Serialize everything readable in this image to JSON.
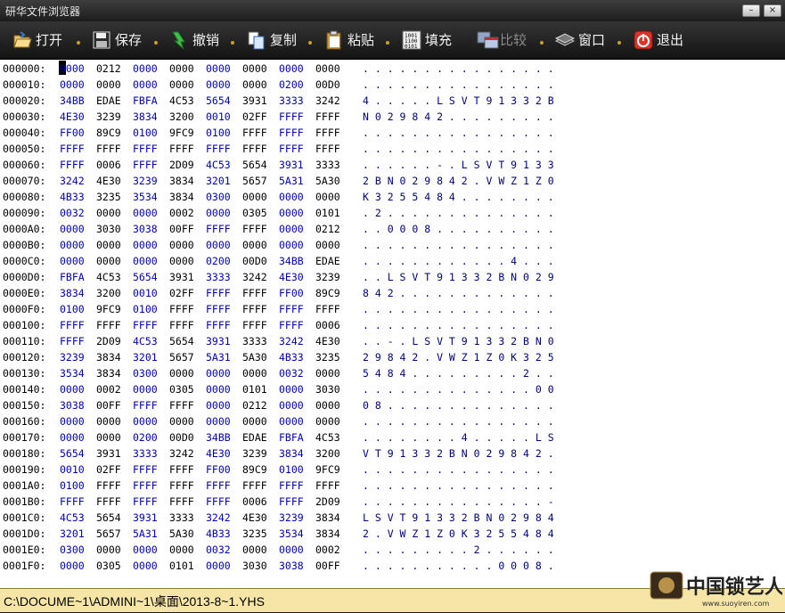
{
  "window": {
    "title": "研华文件浏览器",
    "min_label": "–",
    "close_label": "×"
  },
  "toolbar": {
    "open": "打开",
    "save": "保存",
    "undo": "撤销",
    "copy": "复制",
    "paste": "粘贴",
    "fill": "填充",
    "compare": "比较",
    "window": "窗口",
    "exit": "退出"
  },
  "rows": [
    {
      "a": "000000:",
      "h": [
        "0000",
        "0212",
        "0000",
        "0000",
        "0000",
        "0000",
        "0000",
        "0000"
      ],
      "t": ". . . . . . . . . . . . . . . ."
    },
    {
      "a": "000010:",
      "h": [
        "0000",
        "0000",
        "0000",
        "0000",
        "0000",
        "0000",
        "0200",
        "00D0"
      ],
      "t": ". . . . . . . . . . . . . . . ."
    },
    {
      "a": "000020:",
      "h": [
        "34BB",
        "EDAE",
        "FBFA",
        "4C53",
        "5654",
        "3931",
        "3333",
        "3242"
      ],
      "t": "4 . . . . . L S V T 9 1 3 3 2 B"
    },
    {
      "a": "000030:",
      "h": [
        "4E30",
        "3239",
        "3834",
        "3200",
        "0010",
        "02FF",
        "FFFF",
        "FFFF"
      ],
      "t": "N 0 2 9 8 4 2 . . . . . . . . ."
    },
    {
      "a": "000040:",
      "h": [
        "FF00",
        "89C9",
        "0100",
        "9FC9",
        "0100",
        "FFFF",
        "FFFF",
        "FFFF"
      ],
      "t": ". . . . . . . . . . . . . . . ."
    },
    {
      "a": "000050:",
      "h": [
        "FFFF",
        "FFFF",
        "FFFF",
        "FFFF",
        "FFFF",
        "FFFF",
        "FFFF",
        "FFFF"
      ],
      "t": ". . . . . . . . . . . . . . . ."
    },
    {
      "a": "000060:",
      "h": [
        "FFFF",
        "0006",
        "FFFF",
        "2D09",
        "4C53",
        "5654",
        "3931",
        "3333"
      ],
      "t": ". . . . . . - . L S V T 9 1 3 3"
    },
    {
      "a": "000070:",
      "h": [
        "3242",
        "4E30",
        "3239",
        "3834",
        "3201",
        "5657",
        "5A31",
        "5A30"
      ],
      "t": "2 B N 0 2 9 8 4 2 . V W Z 1 Z 0"
    },
    {
      "a": "000080:",
      "h": [
        "4B33",
        "3235",
        "3534",
        "3834",
        "0300",
        "0000",
        "0000",
        "0000"
      ],
      "t": "K 3 2 5 5 4 8 4 . . . . . . . ."
    },
    {
      "a": "000090:",
      "h": [
        "0032",
        "0000",
        "0000",
        "0002",
        "0000",
        "0305",
        "0000",
        "0101"
      ],
      "t": ". 2 . . . . . . . . . . . . . ."
    },
    {
      "a": "0000A0:",
      "h": [
        "0000",
        "3030",
        "3038",
        "00FF",
        "FFFF",
        "FFFF",
        "0000",
        "0212"
      ],
      "t": ". . 0 0 0 8 . . . . . . . . . ."
    },
    {
      "a": "0000B0:",
      "h": [
        "0000",
        "0000",
        "0000",
        "0000",
        "0000",
        "0000",
        "0000",
        "0000"
      ],
      "t": ". . . . . . . . . . . . . . . ."
    },
    {
      "a": "0000C0:",
      "h": [
        "0000",
        "0000",
        "0000",
        "0000",
        "0200",
        "00D0",
        "34BB",
        "EDAE"
      ],
      "t": ". . . . . . . . . . . . 4 . . ."
    },
    {
      "a": "0000D0:",
      "h": [
        "FBFA",
        "4C53",
        "5654",
        "3931",
        "3333",
        "3242",
        "4E30",
        "3239"
      ],
      "t": ". . L S V T 9 1 3 3 2 B N 0 2 9"
    },
    {
      "a": "0000E0:",
      "h": [
        "3834",
        "3200",
        "0010",
        "02FF",
        "FFFF",
        "FFFF",
        "FF00",
        "89C9"
      ],
      "t": "8 4 2 . . . . . . . . . . . . ."
    },
    {
      "a": "0000F0:",
      "h": [
        "0100",
        "9FC9",
        "0100",
        "FFFF",
        "FFFF",
        "FFFF",
        "FFFF",
        "FFFF"
      ],
      "t": ". . . . . . . . . . . . . . . ."
    },
    {
      "a": "000100:",
      "h": [
        "FFFF",
        "FFFF",
        "FFFF",
        "FFFF",
        "FFFF",
        "FFFF",
        "FFFF",
        "0006"
      ],
      "t": ". . . . . . . . . . . . . . . ."
    },
    {
      "a": "000110:",
      "h": [
        "FFFF",
        "2D09",
        "4C53",
        "5654",
        "3931",
        "3333",
        "3242",
        "4E30"
      ],
      "t": ". . - . L S V T 9 1 3 3 2 B N 0"
    },
    {
      "a": "000120:",
      "h": [
        "3239",
        "3834",
        "3201",
        "5657",
        "5A31",
        "5A30",
        "4B33",
        "3235"
      ],
      "t": "2 9 8 4 2 . V W Z 1 Z 0 K 3 2 5"
    },
    {
      "a": "000130:",
      "h": [
        "3534",
        "3834",
        "0300",
        "0000",
        "0000",
        "0000",
        "0032",
        "0000"
      ],
      "t": "5 4 8 4 . . . . . . . . . 2 . ."
    },
    {
      "a": "000140:",
      "h": [
        "0000",
        "0002",
        "0000",
        "0305",
        "0000",
        "0101",
        "0000",
        "3030"
      ],
      "t": ". . . . . . . . . . . . . . 0 0"
    },
    {
      "a": "000150:",
      "h": [
        "3038",
        "00FF",
        "FFFF",
        "FFFF",
        "0000",
        "0212",
        "0000",
        "0000"
      ],
      "t": "0 8 . . . . . . . . . . . . . ."
    },
    {
      "a": "000160:",
      "h": [
        "0000",
        "0000",
        "0000",
        "0000",
        "0000",
        "0000",
        "0000",
        "0000"
      ],
      "t": ". . . . . . . . . . . . . . . ."
    },
    {
      "a": "000170:",
      "h": [
        "0000",
        "0000",
        "0200",
        "00D0",
        "34BB",
        "EDAE",
        "FBFA",
        "4C53"
      ],
      "t": ". . . . . . . . 4 . . . . . L S"
    },
    {
      "a": "000180:",
      "h": [
        "5654",
        "3931",
        "3333",
        "3242",
        "4E30",
        "3239",
        "3834",
        "3200"
      ],
      "t": "V T 9 1 3 3 2 B N 0 2 9 8 4 2 ."
    },
    {
      "a": "000190:",
      "h": [
        "0010",
        "02FF",
        "FFFF",
        "FFFF",
        "FF00",
        "89C9",
        "0100",
        "9FC9"
      ],
      "t": ". . . . . . . . . . . . . . . ."
    },
    {
      "a": "0001A0:",
      "h": [
        "0100",
        "FFFF",
        "FFFF",
        "FFFF",
        "FFFF",
        "FFFF",
        "FFFF",
        "FFFF"
      ],
      "t": ". . . . . . . . . . . . . . . ."
    },
    {
      "a": "0001B0:",
      "h": [
        "FFFF",
        "FFFF",
        "FFFF",
        "FFFF",
        "FFFF",
        "0006",
        "FFFF",
        "2D09"
      ],
      "t": ". . . . . . . . . . . . . . . -"
    },
    {
      "a": "0001C0:",
      "h": [
        "4C53",
        "5654",
        "3931",
        "3333",
        "3242",
        "4E30",
        "3239",
        "3834"
      ],
      "t": "L S V T 9 1 3 3 2 B N 0 2 9 8 4"
    },
    {
      "a": "0001D0:",
      "h": [
        "3201",
        "5657",
        "5A31",
        "5A30",
        "4B33",
        "3235",
        "3534",
        "3834"
      ],
      "t": "2 . V W Z 1 Z 0 K 3 2 5 5 4 8 4"
    },
    {
      "a": "0001E0:",
      "h": [
        "0300",
        "0000",
        "0000",
        "0000",
        "0032",
        "0000",
        "0000",
        "0002"
      ],
      "t": ". . . . . . . . . 2 . . . . . ."
    },
    {
      "a": "0001F0:",
      "h": [
        "0000",
        "0305",
        "0000",
        "0101",
        "0000",
        "3030",
        "3038",
        "00FF"
      ],
      "t": ". . . . . . . . . . . 0 0 0 8 ."
    }
  ],
  "status": {
    "path": "C:\\DOCUME~1\\ADMINI~1\\桌面\\2013-8~1.YHS"
  },
  "watermark": {
    "text": "中国锁艺人",
    "url": "www.suoyiren.com"
  }
}
